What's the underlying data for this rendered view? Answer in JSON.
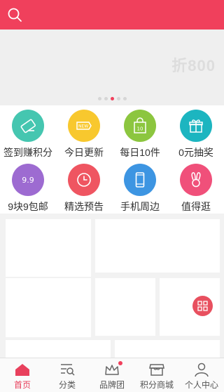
{
  "colors": {
    "accent": "#f0405c",
    "header": "#f0405c"
  },
  "header": {
    "search_icon": "search-icon"
  },
  "banner": {
    "logo_text": "折800",
    "slide_count": 5,
    "active_slide": 3
  },
  "grid": {
    "items": [
      {
        "label": "签到赚积分",
        "icon": "sign-in-ticket-icon",
        "color": "#45c6b0"
      },
      {
        "label": "今日更新",
        "icon": "new-tag-icon",
        "color": "#f8c82e"
      },
      {
        "label": "每日10件",
        "icon": "shopping-bag-icon",
        "icon_text": "10",
        "color": "#8cc63f"
      },
      {
        "label": "0元抽奖",
        "icon": "gift-icon",
        "color": "#1cb5c0"
      },
      {
        "label": "9块9包邮",
        "icon": "nine-nine-icon",
        "icon_text": "9.9",
        "color": "#9d6bd1"
      },
      {
        "label": "精选预告",
        "icon": "clock-icon",
        "color": "#ef5561"
      },
      {
        "label": "手机周边",
        "icon": "mobile-phone-icon",
        "color": "#3d95e2"
      },
      {
        "label": "值得逛",
        "icon": "bunny-ears-icon",
        "color": "#f0507a"
      }
    ]
  },
  "tabbar": {
    "items": [
      {
        "label": "首页",
        "icon": "home-icon",
        "active": true
      },
      {
        "label": "分类",
        "icon": "category-search-icon",
        "active": false
      },
      {
        "label": "品牌团",
        "icon": "crown-icon",
        "active": false,
        "badge": true
      },
      {
        "label": "积分商城",
        "icon": "shop-icon",
        "active": false
      },
      {
        "label": "个人中心",
        "icon": "user-icon",
        "active": false
      }
    ]
  }
}
